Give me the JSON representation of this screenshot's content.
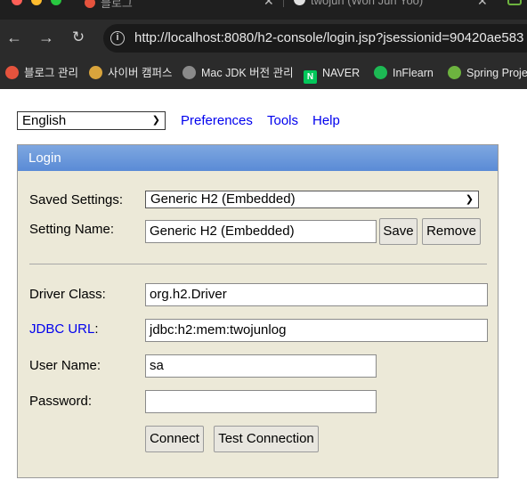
{
  "browser": {
    "tabs": [
      {
        "title": "블로그"
      },
      {
        "title": "twojun (Won Jun Yoo)"
      }
    ],
    "url": "http://localhost:8080/h2-console/login.jsp?jsessionid=90420ae583",
    "bookmarks": [
      {
        "label": "블로그 관리",
        "icon": "tistory-icon",
        "color": "#e5533d"
      },
      {
        "label": "사이버 캠퍼스",
        "icon": "campus-icon",
        "color": "#d9a43c"
      },
      {
        "label": "Mac JDK 버전 관리",
        "icon": "globe-icon",
        "color": "#8a8a8a"
      },
      {
        "label": "NAVER",
        "icon": "naver-icon",
        "color": "#03c75a"
      },
      {
        "label": "InFlearn",
        "icon": "inflearn-icon",
        "color": "#1db954"
      },
      {
        "label": "Spring Proje",
        "icon": "spring-icon",
        "color": "#6db33f"
      }
    ]
  },
  "topbar": {
    "language": "English",
    "links": [
      "Preferences",
      "Tools",
      "Help"
    ]
  },
  "login": {
    "title": "Login",
    "saved_settings_label": "Saved Settings:",
    "saved_settings_value": "Generic H2 (Embedded)",
    "setting_name_label": "Setting Name:",
    "setting_name_value": "Generic H2 (Embedded)",
    "save_label": "Save",
    "remove_label": "Remove",
    "driver_class_label": "Driver Class:",
    "driver_class_value": "org.h2.Driver",
    "jdbc_url_label": "JDBC URL",
    "jdbc_url_colon": ":",
    "jdbc_url_value": "jdbc:h2:mem:twojunlog",
    "user_name_label": "User Name:",
    "user_name_value": "sa",
    "password_label": "Password:",
    "password_value": "",
    "connect_label": "Connect",
    "test_label": "Test Connection"
  },
  "colors": {
    "header_gradient_top": "#7ea7e0",
    "header_gradient_bottom": "#5a8bd6",
    "panel_bg": "#ece9d8",
    "link": "#0000ee"
  }
}
